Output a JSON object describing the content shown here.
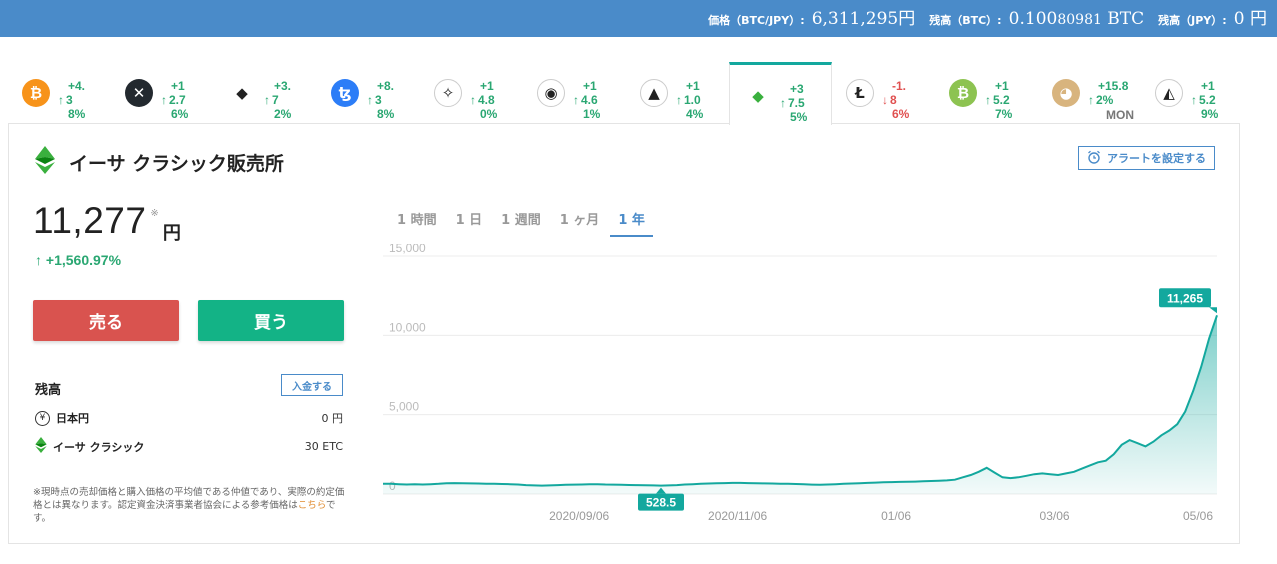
{
  "header": {
    "price_label": "価格（BTC/JPY）:",
    "price_value": "6,311,295円",
    "btc_label": "残高（BTC）:",
    "btc_value_main": "0.100",
    "btc_value_small": "80981",
    "btc_value_unit": " BTC",
    "jpy_label": "残高（JPY）:",
    "jpy_value": "0 円"
  },
  "coins": [
    {
      "icon": "bitcoin-icon",
      "glyph": "₿",
      "color": "#f7931a",
      "line1": "+4.",
      "line2": "3",
      "line3": "8%",
      "dir": "up"
    },
    {
      "icon": "xrp-icon",
      "glyph": "✕",
      "color": "#23292f",
      "line1": "+1",
      "line2": "2.7",
      "line3": "6%",
      "dir": "up"
    },
    {
      "icon": "ethereum-icon",
      "glyph": "◆",
      "color": "#ffffff",
      "line1": "+3.",
      "line2": "7",
      "line3": "2%",
      "dir": "up"
    },
    {
      "icon": "tezos-icon",
      "glyph": "ꜩ",
      "color": "#2c7df7",
      "line1": "+8.",
      "line2": "3",
      "line3": "8%",
      "dir": "up"
    },
    {
      "icon": "stellar-icon",
      "glyph": "✧",
      "color": "#ffffff",
      "line1": "+1",
      "line2": "4.8",
      "line3": "0%",
      "dir": "up"
    },
    {
      "icon": "nem-icon",
      "glyph": "◉",
      "color": "#ffffff",
      "line1": "+1",
      "line2": "4.6",
      "line3": "1%",
      "dir": "up"
    },
    {
      "icon": "bat-icon",
      "glyph": "▲",
      "color": "#ffffff",
      "line1": "+1",
      "line2": "1.0",
      "line3": "4%",
      "dir": "up"
    },
    {
      "icon": "ethereum-classic-icon",
      "glyph": "◆",
      "color": "#ffffff",
      "line1": "+3",
      "line2": "7.5",
      "line3": "5%",
      "dir": "up",
      "active": true
    },
    {
      "icon": "litecoin-icon",
      "glyph": "Ł",
      "color": "#ffffff",
      "line1": "-1.",
      "line2": "8",
      "line3": "6%",
      "dir": "down"
    },
    {
      "icon": "bitcoin-cash-icon",
      "glyph": "₿",
      "color": "#8dc351",
      "line1": "+1",
      "line2": "5.2",
      "line3": "7%",
      "dir": "up"
    },
    {
      "icon": "monacoin-icon",
      "glyph": "◕",
      "color": "#d8b47e",
      "line1": "+15.8",
      "line2": "2%",
      "line3": "",
      "extra": "MON",
      "dir": "up"
    },
    {
      "icon": "lisk-icon",
      "glyph": "◭",
      "color": "#ffffff",
      "line1": "+1",
      "line2": "5.2",
      "line3": "9%",
      "dir": "up"
    }
  ],
  "main": {
    "title": "イーサ クラシック販売所",
    "alert_label": "アラートを設定する",
    "price": "11,277",
    "price_asterisk": "※",
    "price_unit": "円",
    "change": "+1,560.97%",
    "sell_label": "売る",
    "buy_label": "買う"
  },
  "balance": {
    "title": "残高",
    "deposit_label": "入金する",
    "rows": [
      {
        "name": "日本円",
        "value": "0 円"
      },
      {
        "name": "イーサ クラシック",
        "value": "30 ETC"
      }
    ],
    "note_text": "※現時点の売却価格と購入価格の平均値である仲値であり、実際の約定価格とは異なります。認定資金決済事業者協会による参考価格は",
    "note_link": "こちら",
    "note_end": "です。"
  },
  "periods": [
    {
      "label": "1 時間",
      "active": false
    },
    {
      "label": "1 日",
      "active": false
    },
    {
      "label": "1 週間",
      "active": false
    },
    {
      "label": "1 ヶ月",
      "active": false
    },
    {
      "label": "1 年",
      "active": true
    }
  ],
  "chart_data": {
    "type": "area",
    "color": "#13a89e",
    "ylim": [
      0,
      15000
    ],
    "yticks": [
      0,
      5000,
      10000,
      15000
    ],
    "ytick_labels": [
      "0",
      "5,000",
      "10,000",
      "15,000"
    ],
    "xtick_labels": [
      "2020/09/06",
      "2020/11/06",
      "01/06",
      "03/06",
      "05/06"
    ],
    "min_label": "528.5",
    "max_label": "11,265",
    "series": [
      {
        "values": [
          650,
          640,
          620,
          600,
          610,
          600,
          620,
          640,
          680,
          690,
          680,
          670,
          660,
          650,
          640,
          630,
          620,
          600,
          560,
          540,
          530,
          540,
          560,
          580,
          590,
          600,
          610,
          620,
          600,
          590,
          580,
          570,
          560,
          550,
          540,
          528.5,
          545,
          560,
          600,
          620,
          640,
          660,
          680,
          690,
          700,
          700,
          690,
          680,
          670,
          660,
          650,
          640,
          630,
          610,
          590,
          580,
          600,
          620,
          640,
          660,
          680,
          700,
          720,
          740,
          750,
          760,
          770,
          780,
          800,
          820,
          840,
          860,
          900,
          1050,
          1200,
          1400,
          1650,
          1350,
          1050,
          1000,
          1050,
          1150,
          1250,
          1300,
          1250,
          1200,
          1300,
          1400,
          1600,
          1800,
          2000,
          2100,
          2500,
          3100,
          3400,
          3200,
          3000,
          3300,
          3700,
          4000,
          4400,
          5200,
          6500,
          8000,
          9800,
          11265
        ]
      }
    ]
  }
}
